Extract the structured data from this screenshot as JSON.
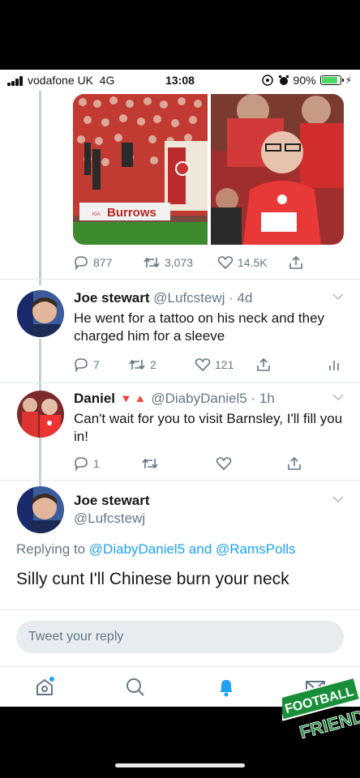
{
  "status_bar": {
    "carrier": "vodafone UK",
    "network": "4G",
    "time": "13:08",
    "battery": "90%"
  },
  "media": {
    "stadium_sign": "Burrows",
    "sponsor": "KIA"
  },
  "original_tweet_actions": {
    "replies": "877",
    "retweets": "3,073",
    "likes": "14.5K"
  },
  "tweets": [
    {
      "name": "Joe stewart",
      "handle": "@Lufcstewj",
      "time": "· 4d",
      "text": "He went for a tattoo on his neck and they charged him for a sleeve",
      "replies": "7",
      "retweets": "2",
      "likes": "121"
    },
    {
      "name": "Daniel",
      "name_emoji": "🔻🔺",
      "handle": "@DiabyDaniel5",
      "time": "· 1h",
      "text": "Can't wait for you to visit Barnsley, I'll fill you in!",
      "replies": "1"
    }
  ],
  "focused_tweet": {
    "name": "Joe stewart",
    "handle": "@Lufcstewj",
    "replying_prefix": "Replying to",
    "replying_user1": "@DiabyDaniel5",
    "replying_and": "and",
    "replying_user2": "@RamsPolls",
    "text": "Silly cunt I'll Chinese burn your neck"
  },
  "reply_box": {
    "placeholder": "Tweet your reply"
  },
  "tabbar": [
    "home-icon",
    "search-icon",
    "notifications-icon",
    "messages-icon"
  ],
  "watermark": {
    "line1": "FOOTBALL",
    "line2": "FRIENDS"
  },
  "colors": {
    "twitter_blue": "#1da1f2",
    "text_gray": "#657786",
    "thread_line": "#c4cfd6"
  }
}
